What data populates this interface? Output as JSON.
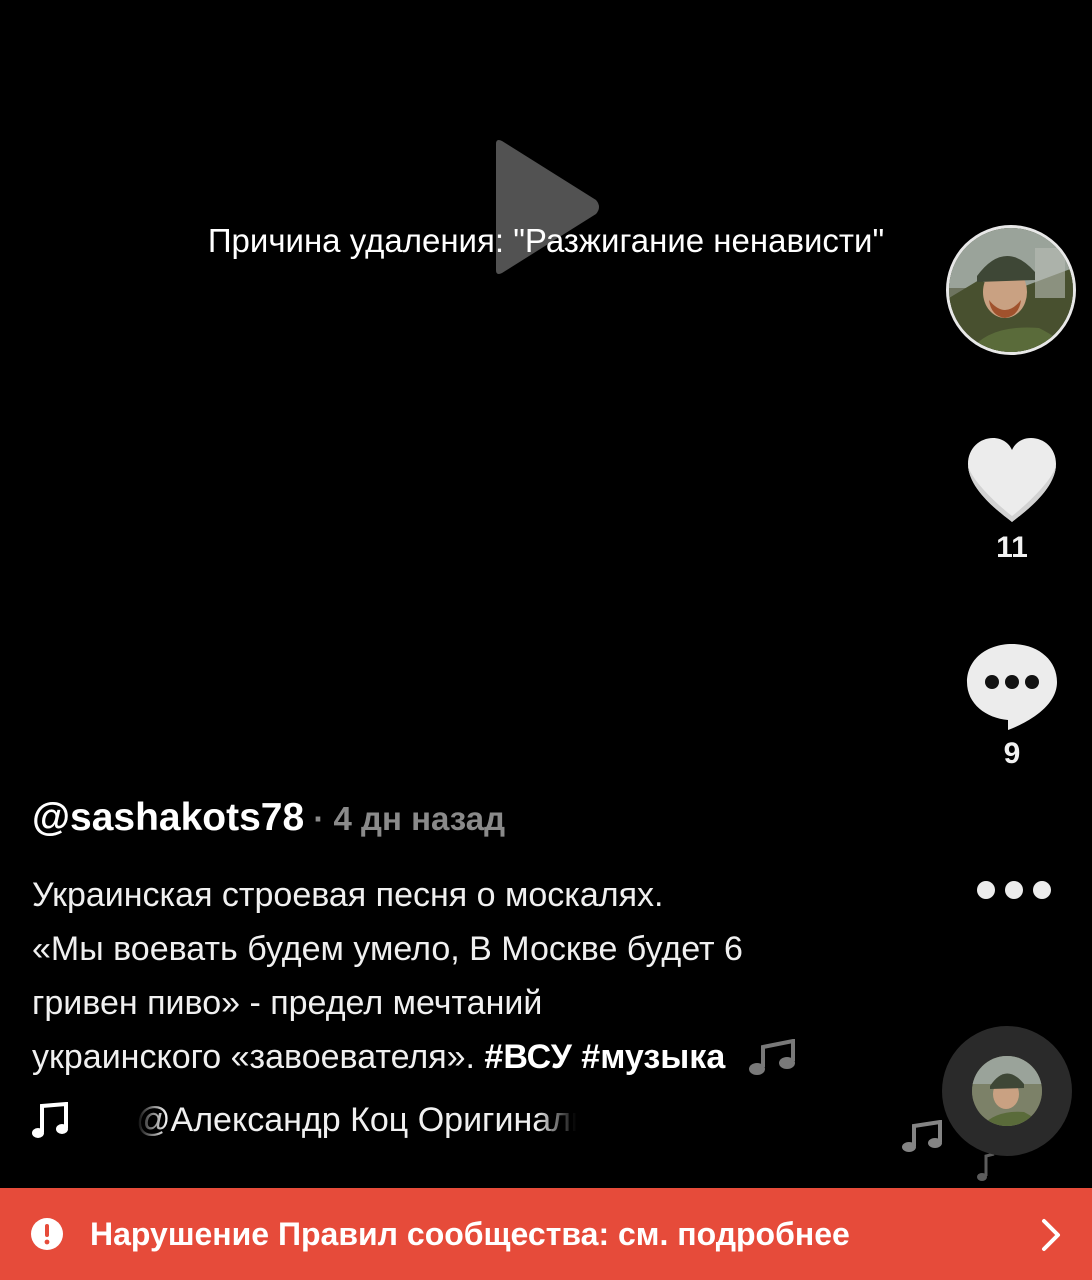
{
  "video": {
    "removal_reason": "Причина удаления: \"Разжигание ненависти\""
  },
  "actions": {
    "likes": "11",
    "comments": "9"
  },
  "post": {
    "username": "@sashakots78",
    "separator": " · ",
    "time_ago": "4 дн назад",
    "caption_lines": [
      "Украинская строевая песня о москалях.",
      "«Мы воевать будем умело, В Москве будет 6",
      "гривен пиво» - предел мечтаний",
      "украинского «завоевателя». "
    ],
    "hashtags": "#ВСУ #музыка"
  },
  "music": {
    "track": "@Александр Коц Оригинальный звук"
  },
  "banner": {
    "text": "Нарушение Правил сообщества: см. подробнее"
  },
  "colors": {
    "background": "#000000",
    "banner": "#e64b3a",
    "time_text": "#8a8a8a"
  },
  "icons": {
    "play": "play-icon",
    "like": "heart-icon",
    "comment": "comment-bubble-icon",
    "more": "more-dots-icon",
    "music": "music-note-icon",
    "alert": "alert-circle-icon",
    "chevron": "chevron-right-icon"
  }
}
